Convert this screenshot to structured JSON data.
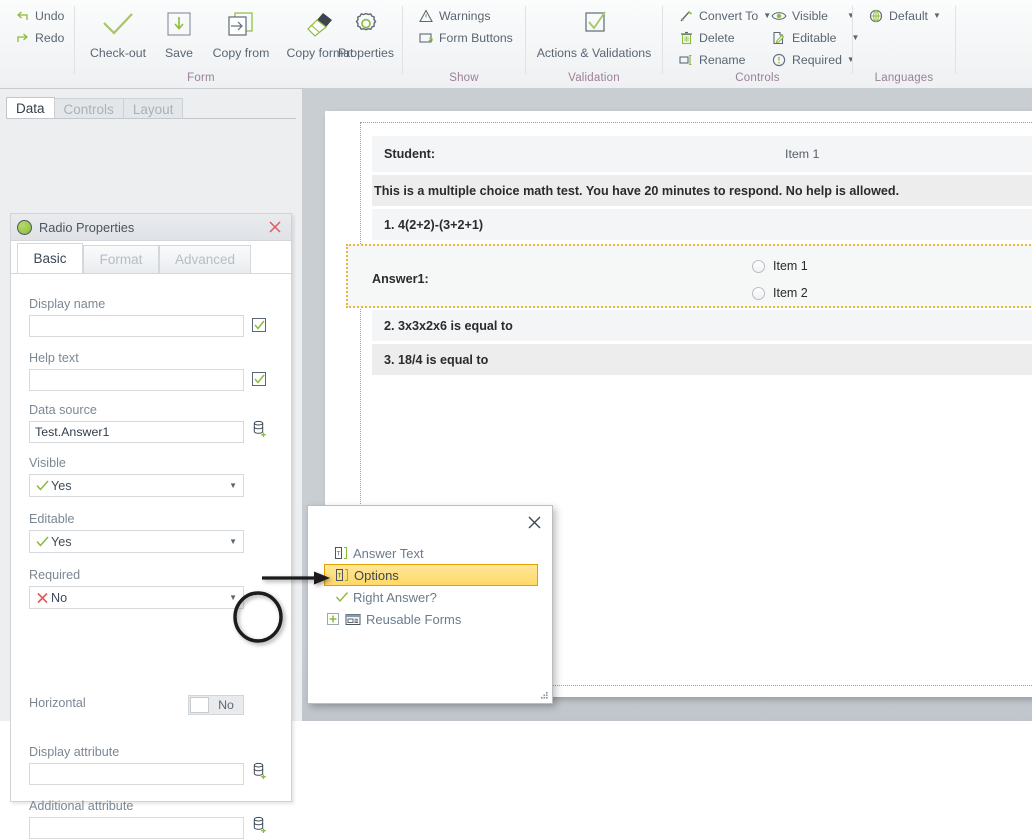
{
  "ribbon": {
    "groups": [
      {
        "name": "Form",
        "label": "Form",
        "small_buttons": [
          {
            "label": "Undo",
            "icon": "undo-icon"
          },
          {
            "label": "Redo",
            "icon": "redo-icon"
          }
        ],
        "big_buttons": [
          {
            "label": "Check-out",
            "icon": "checkmark-icon"
          },
          {
            "label": "Save",
            "icon": "save-download-icon"
          },
          {
            "label": "Copy from",
            "icon": "copy-from-icon"
          },
          {
            "label": "Copy format",
            "icon": "paintbrush-icon"
          },
          {
            "label": "Properties",
            "icon": "gear-icon"
          }
        ]
      },
      {
        "name": "Show",
        "label": "Show",
        "small_buttons": [
          {
            "label": "Warnings",
            "icon": "warning-triangle-icon"
          },
          {
            "label": "Form Buttons",
            "icon": "form-buttons-icon"
          }
        ],
        "big_buttons": []
      },
      {
        "name": "Validation",
        "label": "Validation",
        "small_buttons": [],
        "big_buttons": [
          {
            "label": "Actions & Validations",
            "icon": "checkbox-check-icon"
          }
        ]
      },
      {
        "name": "Controls",
        "label": "Controls",
        "small_buttons": [
          {
            "label": "Convert To",
            "icon": "wand-icon",
            "caret": true
          },
          {
            "label": "Delete",
            "icon": "trash-icon"
          },
          {
            "label": "Rename",
            "icon": "rename-icon"
          },
          {
            "label": "Visible",
            "icon": "eye-icon",
            "caret": true
          },
          {
            "label": "Editable",
            "icon": "edit-page-icon",
            "caret": true
          },
          {
            "label": "Required",
            "icon": "exclamation-circle-icon",
            "caret": true
          }
        ],
        "big_buttons": []
      },
      {
        "name": "Languages",
        "label": "Languages",
        "small_buttons": [
          {
            "label": "Default",
            "icon": "globe-icon",
            "caret": true
          }
        ],
        "big_buttons": []
      }
    ]
  },
  "left_panel": {
    "tabs": [
      {
        "label": "Data",
        "active": true
      },
      {
        "label": "Controls",
        "active": false
      },
      {
        "label": "Layout",
        "active": false
      }
    ],
    "properties": {
      "title": "Radio Properties",
      "close_label": "✕",
      "subtabs": [
        {
          "label": "Basic",
          "active": true
        },
        {
          "label": "Format",
          "active": false
        },
        {
          "label": "Advanced",
          "active": false
        }
      ],
      "fields": {
        "display_name": {
          "label": "Display name",
          "value": "",
          "placeholder": ""
        },
        "help_text": {
          "label": "Help text",
          "value": "",
          "placeholder": ""
        },
        "data_source": {
          "label": "Data source",
          "value": "Test.Answer1",
          "placeholder": ""
        },
        "visible": {
          "label": "Visible",
          "value": "Yes",
          "icon": "check-icon"
        },
        "editable": {
          "label": "Editable",
          "value": "Yes",
          "icon": "check-icon"
        },
        "required": {
          "label": "Required",
          "value": "No",
          "icon": "cross-icon"
        },
        "horizontal": {
          "label": "Horizontal",
          "value": "No"
        },
        "display_attribute": {
          "label": "Display attribute",
          "value": "",
          "placeholder": ""
        },
        "additional_attribute": {
          "label": "Additional attribute",
          "value": "",
          "placeholder": ""
        }
      }
    }
  },
  "form_preview": {
    "header_item": "Item 1",
    "rows": [
      {
        "label": "Student:",
        "type": "field"
      },
      {
        "label": "This is a multiple choice math test. You have 20 minutes to respond. No help is allowed.",
        "type": "text"
      },
      {
        "label": "1. 4(2+2)-(3+2+1)",
        "type": "text"
      },
      {
        "label": "2. 3x3x2x6 is equal to",
        "type": "text"
      },
      {
        "label": "3. 18/4 is equal to",
        "type": "text"
      }
    ],
    "selected_control": {
      "label": "Answer1:",
      "options": [
        "Item 1",
        "Item 2"
      ]
    }
  },
  "popup": {
    "close_label": "✕",
    "tree": [
      {
        "label": "Answer Text",
        "icon": "text-attribute-icon",
        "selected": false
      },
      {
        "label": "Options",
        "icon": "text-attribute-icon",
        "selected": true
      },
      {
        "label": "Right Answer?",
        "icon": "check-icon",
        "selected": false
      },
      {
        "label": "Reusable Forms",
        "icon": "forms-node-icon",
        "expander": "plus-icon",
        "selected": false
      }
    ]
  },
  "colors": {
    "accent_green": "#8cbb3a",
    "highlight_yellow": "#ffd866",
    "highlight_border": "#e0a200",
    "selection_dotted": "#e8b83b",
    "group_label": "#9b7f9b",
    "text_primary": "#4a5a69",
    "canvas_bg": "#c9ced3"
  }
}
